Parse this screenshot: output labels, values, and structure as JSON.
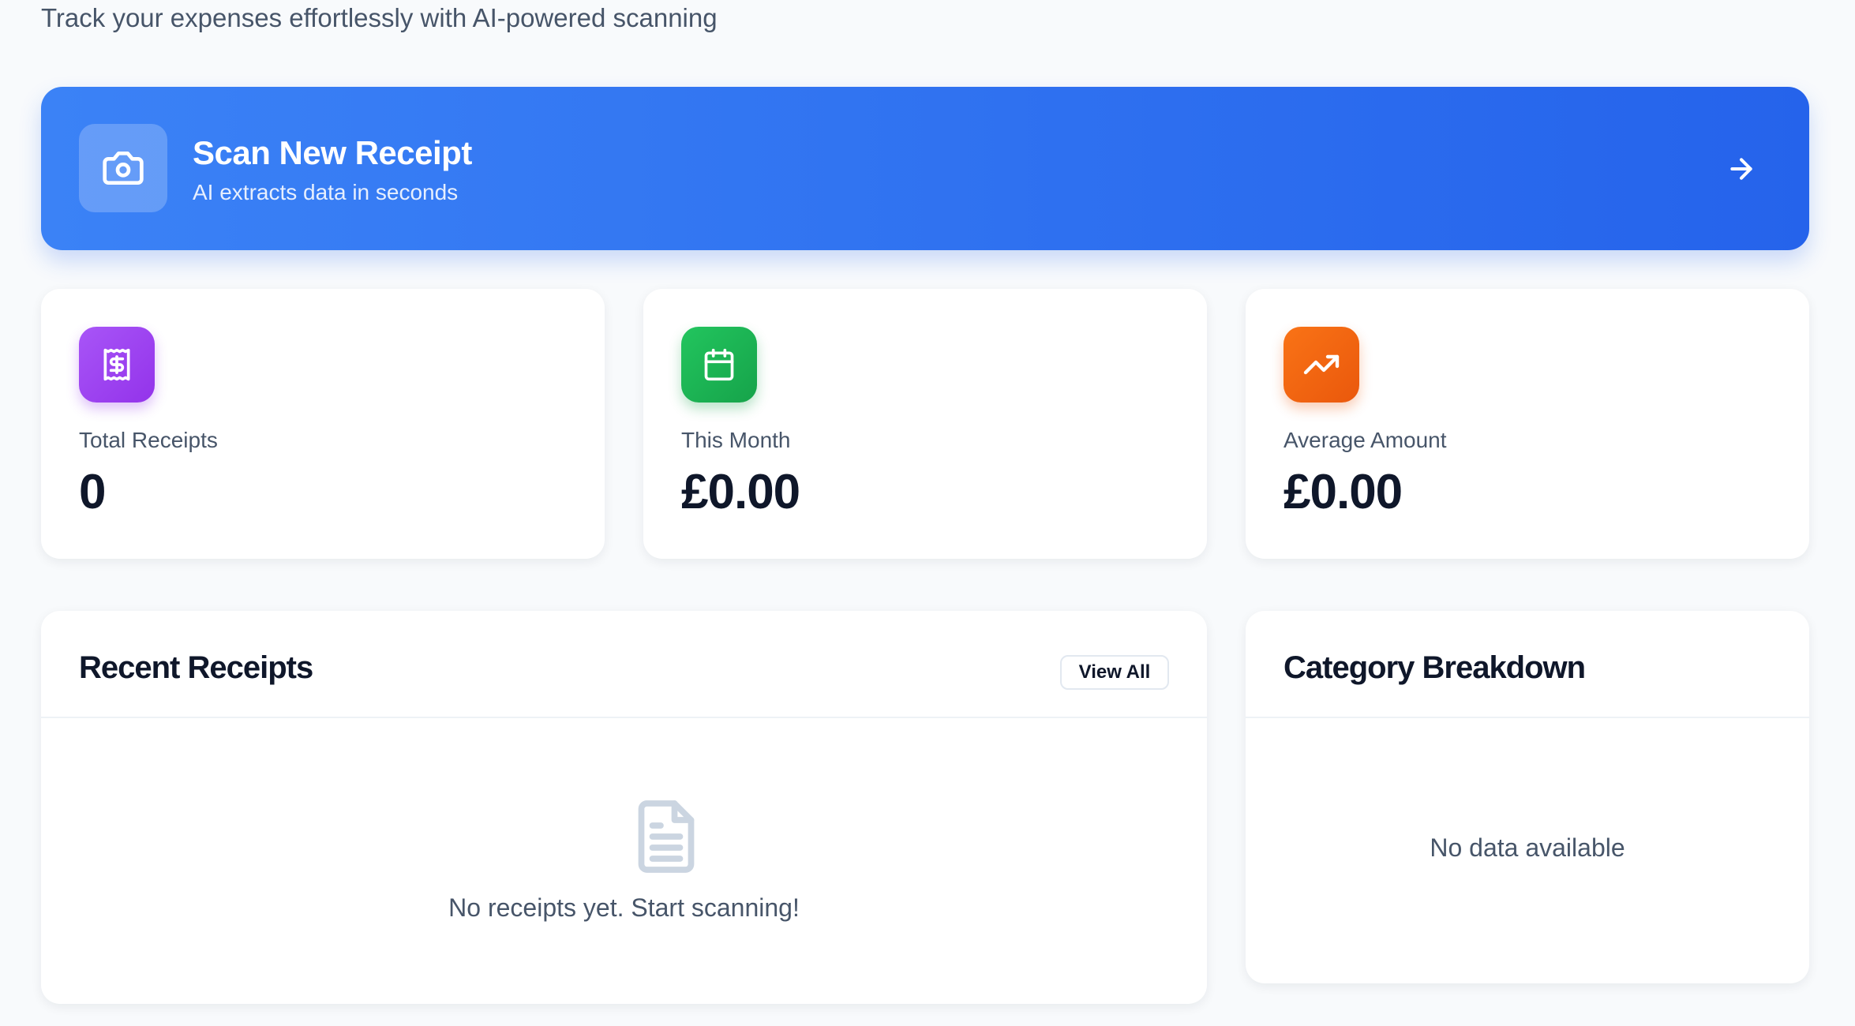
{
  "header": {
    "subtitle": "Track your expenses effortlessly with AI-powered scanning"
  },
  "scan_banner": {
    "title": "Scan New Receipt",
    "subtitle": "AI extracts data in seconds",
    "icon": "camera-icon",
    "action_icon": "arrow-right-icon",
    "gradient": [
      "#3b82f6",
      "#2563eb"
    ]
  },
  "stats": [
    {
      "label": "Total Receipts",
      "value": "0",
      "icon": "receipt-icon",
      "color": "#9333ea"
    },
    {
      "label": "This Month",
      "value": "£0.00",
      "icon": "calendar-icon",
      "color": "#16a34a"
    },
    {
      "label": "Average Amount",
      "value": "£0.00",
      "icon": "trending-up-icon",
      "color": "#ea580c"
    }
  ],
  "recent_receipts": {
    "title": "Recent Receipts",
    "view_all_label": "View All",
    "empty_icon": "document-icon",
    "empty_message": "No receipts yet. Start scanning!"
  },
  "category_breakdown": {
    "title": "Category Breakdown",
    "empty_message": "No data available"
  }
}
